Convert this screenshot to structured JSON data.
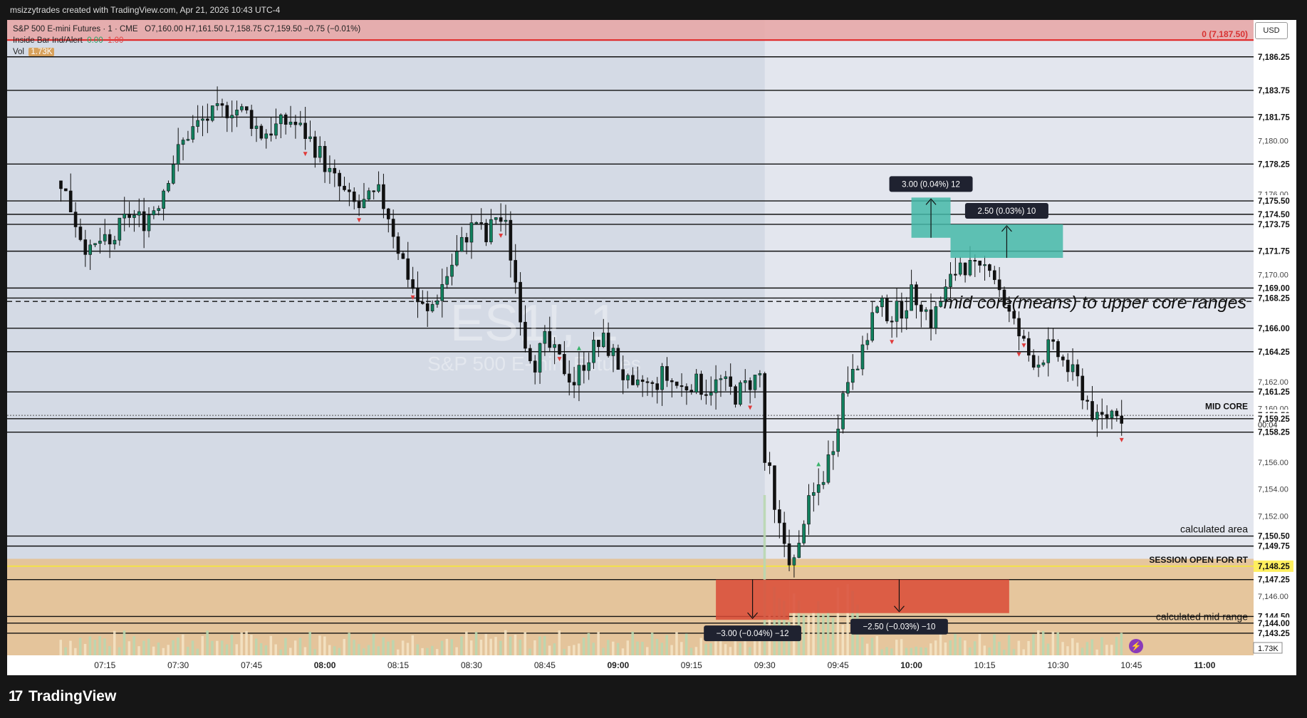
{
  "header": {
    "created_by": "msizzytrades created with TradingView.com, Apr 21, 2026 10:43 UTC-4"
  },
  "legend": {
    "symbol_line": "S&P 500 E-mini Futures · 1 · CME",
    "ohlc": "O7,160.00  H7,161.50  L7,158.75  C7,159.50  −0.75 (−0.01%)",
    "indicator_name": "Inside Bar Ind/Alert",
    "indicator_v1": "0.00",
    "indicator_v2": "1.00",
    "vol_label": "Vol",
    "vol_value": "1.73K"
  },
  "watermark": {
    "symbol": "ES1!, 1",
    "name": "S&P 500 E-mini Futures"
  },
  "currency": "USD",
  "footer": {
    "brand": "TradingView",
    "brand_mark": "17"
  },
  "chart_data": {
    "type": "candlestick",
    "title": "S&P 500 E-mini Futures · 1 · CME",
    "ylim": [
      7141.6,
      7189.0
    ],
    "x_ticks": [
      "07:15",
      "07:30",
      "07:45",
      "08:00",
      "08:15",
      "08:30",
      "08:45",
      "09:00",
      "09:15",
      "09:30",
      "09:45",
      "10:00",
      "10:15",
      "10:30",
      "10:45",
      "11:00"
    ],
    "y_ticks": [
      "7,180.00",
      "7,176.00",
      "7,170.00",
      "7,162.00",
      "7,160.00",
      "7,156.00",
      "7,154.00",
      "7,152.00",
      "7,146.00"
    ],
    "horizontal_levels": [
      7186.25,
      7183.75,
      7181.75,
      7178.25,
      7175.5,
      7174.5,
      7173.75,
      7171.75,
      7169.0,
      7168.25,
      7166.0,
      7164.25,
      7161.25,
      7159.25,
      7158.25,
      7150.5,
      7149.75,
      7147.25,
      7144.5,
      7144.0,
      7143.25
    ],
    "price_labels": [
      {
        "price": 7186.25,
        "text": "7,186.25",
        "style": "dark"
      },
      {
        "price": 7183.75,
        "text": "7,183.75",
        "style": "dark"
      },
      {
        "price": 7181.75,
        "text": "7,181.75",
        "style": "dark"
      },
      {
        "price": 7178.25,
        "text": "7,178.25",
        "style": "dark"
      },
      {
        "price": 7175.5,
        "text": "7,175.50",
        "style": "dark"
      },
      {
        "price": 7174.5,
        "text": "7,174.50",
        "style": "dark"
      },
      {
        "price": 7173.75,
        "text": "7,173.75",
        "style": "dark"
      },
      {
        "price": 7171.75,
        "text": "7,171.75",
        "style": "dark"
      },
      {
        "price": 7169.0,
        "text": "7,169.00",
        "style": "dark"
      },
      {
        "price": 7168.25,
        "text": "7,168.25",
        "style": "dark"
      },
      {
        "price": 7166.0,
        "text": "7,166.00",
        "style": "dark"
      },
      {
        "price": 7164.25,
        "text": "7,164.25",
        "style": "dark"
      },
      {
        "price": 7161.25,
        "text": "7,161.25",
        "style": "dark"
      },
      {
        "price": 7159.5,
        "text": "7,159.50",
        "style": "dark"
      },
      {
        "price": 7159.25,
        "text": "7,159.25",
        "style": "dark"
      },
      {
        "price": 7158.25,
        "text": "7,158.25",
        "style": "dark"
      },
      {
        "price": 7150.5,
        "text": "7,150.50",
        "style": "dark"
      },
      {
        "price": 7149.75,
        "text": "7,149.75",
        "style": "dark"
      },
      {
        "price": 7148.25,
        "text": "7,148.25",
        "style": "yellow"
      },
      {
        "price": 7147.25,
        "text": "7,147.25",
        "style": "dark"
      },
      {
        "price": 7144.5,
        "text": "7,144.50",
        "style": "dark"
      },
      {
        "price": 7144.0,
        "text": "7,144.00",
        "style": "dark"
      },
      {
        "price": 7143.25,
        "text": "7,143.25",
        "style": "dark"
      }
    ],
    "countdown": "00:04",
    "volume_label": "1.73K",
    "right_annotations": [
      {
        "price": 7187.5,
        "text": "0 (7,187.50)"
      },
      {
        "price": 7159.7,
        "text": "MID CORE"
      },
      {
        "price": 7150.5,
        "text": "calculated area"
      },
      {
        "price": 7148.25,
        "text": "SESSION OPEN FOR RT"
      },
      {
        "price": 7144.5,
        "text": "calculated mid range"
      }
    ],
    "center_annotation": {
      "price": 7168.0,
      "text": "mid core(means) to upper core ranges"
    },
    "zones": [
      {
        "name": "upper-resistance-band",
        "from": 7187.5,
        "to": 7191.0,
        "color": "#e8a5a5"
      },
      {
        "name": "lower-support-band",
        "from": 7141.6,
        "to": 7148.8,
        "color": "#e6c08e"
      }
    ],
    "measures": [
      {
        "label": "3.00 (0.04%) 12",
        "from": 7172.75,
        "to": 7175.75,
        "t0": "10:00",
        "t1": "10:08",
        "kind": "long"
      },
      {
        "label": "2.50 (0.03%) 10",
        "from": 7171.25,
        "to": 7173.75,
        "t0": "10:08",
        "t1": "10:31",
        "kind": "long"
      },
      {
        "label": "−3.00 (−0.04%) −12",
        "from": 7147.25,
        "to": 7144.25,
        "t0": "09:20",
        "t1": "09:35",
        "kind": "short"
      },
      {
        "label": "−2.50 (−0.03%) −10",
        "from": 7147.25,
        "to": 7144.75,
        "t0": "09:35",
        "t1": "10:20",
        "kind": "short"
      }
    ],
    "price_path": [
      [
        "07:06",
        7177.0
      ],
      [
        "07:08",
        7175.0
      ],
      [
        "07:10",
        7173.0
      ],
      [
        "07:12",
        7171.5
      ],
      [
        "07:14",
        7172.5
      ],
      [
        "07:16",
        7172.0
      ],
      [
        "07:18",
        7173.5
      ],
      [
        "07:20",
        7174.5
      ],
      [
        "07:23",
        7174.0
      ],
      [
        "07:26",
        7175.5
      ],
      [
        "07:29",
        7178.5
      ],
      [
        "07:32",
        7180.5
      ],
      [
        "07:35",
        7181.5
      ],
      [
        "07:38",
        7182.0
      ],
      [
        "07:41",
        7182.5
      ],
      [
        "07:44",
        7182.0
      ],
      [
        "07:47",
        7180.5
      ],
      [
        "07:50",
        7181.0
      ],
      [
        "07:53",
        7181.5
      ],
      [
        "07:56",
        7180.5
      ],
      [
        "07:59",
        7179.0
      ],
      [
        "08:01",
        7177.5
      ],
      [
        "08:03",
        7176.5
      ],
      [
        "08:05",
        7175.5
      ],
      [
        "08:07",
        7175.0
      ],
      [
        "08:09",
        7175.5
      ],
      [
        "08:11",
        7176.0
      ],
      [
        "08:13",
        7174.5
      ],
      [
        "08:15",
        7172.0
      ],
      [
        "08:17",
        7170.0
      ],
      [
        "08:19",
        7168.0
      ],
      [
        "08:21",
        7167.0
      ],
      [
        "08:23",
        7168.5
      ],
      [
        "08:25",
        7170.0
      ],
      [
        "08:27",
        7171.5
      ],
      [
        "08:29",
        7173.0
      ],
      [
        "08:31",
        7174.0
      ],
      [
        "08:33",
        7172.5
      ],
      [
        "08:35",
        7174.5
      ],
      [
        "08:37",
        7173.5
      ],
      [
        "08:39",
        7169.5
      ],
      [
        "08:41",
        7165.0
      ],
      [
        "08:43",
        7163.5
      ],
      [
        "08:45",
        7165.0
      ],
      [
        "08:47",
        7164.0
      ],
      [
        "08:49",
        7163.0
      ],
      [
        "08:51",
        7162.0
      ],
      [
        "08:53",
        7163.5
      ],
      [
        "08:55",
        7164.5
      ],
      [
        "08:57",
        7165.0
      ],
      [
        "08:59",
        7164.0
      ],
      [
        "09:01",
        7162.5
      ],
      [
        "09:03",
        7161.0
      ],
      [
        "09:05",
        7162.0
      ],
      [
        "09:07",
        7161.5
      ],
      [
        "09:09",
        7162.5
      ],
      [
        "09:11",
        7162.0
      ],
      [
        "09:13",
        7161.5
      ],
      [
        "09:15",
        7162.0
      ],
      [
        "09:18",
        7161.5
      ],
      [
        "09:21",
        7162.0
      ],
      [
        "09:24",
        7161.0
      ],
      [
        "09:27",
        7162.0
      ],
      [
        "09:29",
        7162.5
      ],
      [
        "09:30",
        7156.0
      ],
      [
        "09:31",
        7155.0
      ],
      [
        "09:32",
        7152.0
      ],
      [
        "09:34",
        7150.0
      ],
      [
        "09:35",
        7149.0
      ],
      [
        "09:36",
        7148.5
      ],
      [
        "09:37",
        7149.5
      ],
      [
        "09:38",
        7152.0
      ],
      [
        "09:40",
        7153.5
      ],
      [
        "09:42",
        7155.0
      ],
      [
        "09:44",
        7157.5
      ],
      [
        "09:46",
        7161.0
      ],
      [
        "09:48",
        7163.5
      ],
      [
        "09:50",
        7164.0
      ],
      [
        "09:52",
        7167.0
      ],
      [
        "09:54",
        7167.5
      ],
      [
        "09:56",
        7167.0
      ],
      [
        "09:58",
        7167.5
      ],
      [
        "10:00",
        7168.5
      ],
      [
        "10:02",
        7168.0
      ],
      [
        "10:04",
        7166.5
      ],
      [
        "10:06",
        7168.0
      ],
      [
        "10:08",
        7169.5
      ],
      [
        "10:10",
        7171.0
      ],
      [
        "10:12",
        7170.5
      ],
      [
        "10:14",
        7170.0
      ],
      [
        "10:16",
        7171.0
      ],
      [
        "10:18",
        7169.0
      ],
      [
        "10:20",
        7167.0
      ],
      [
        "10:22",
        7165.5
      ],
      [
        "10:24",
        7164.0
      ],
      [
        "10:26",
        7163.5
      ],
      [
        "10:28",
        7164.5
      ],
      [
        "10:30",
        7164.0
      ],
      [
        "10:32",
        7163.0
      ],
      [
        "10:34",
        7162.0
      ],
      [
        "10:36",
        7160.5
      ],
      [
        "10:38",
        7159.0
      ],
      [
        "10:40",
        7159.5
      ],
      [
        "10:42",
        7160.0
      ],
      [
        "10:43",
        7159.5
      ]
    ]
  }
}
